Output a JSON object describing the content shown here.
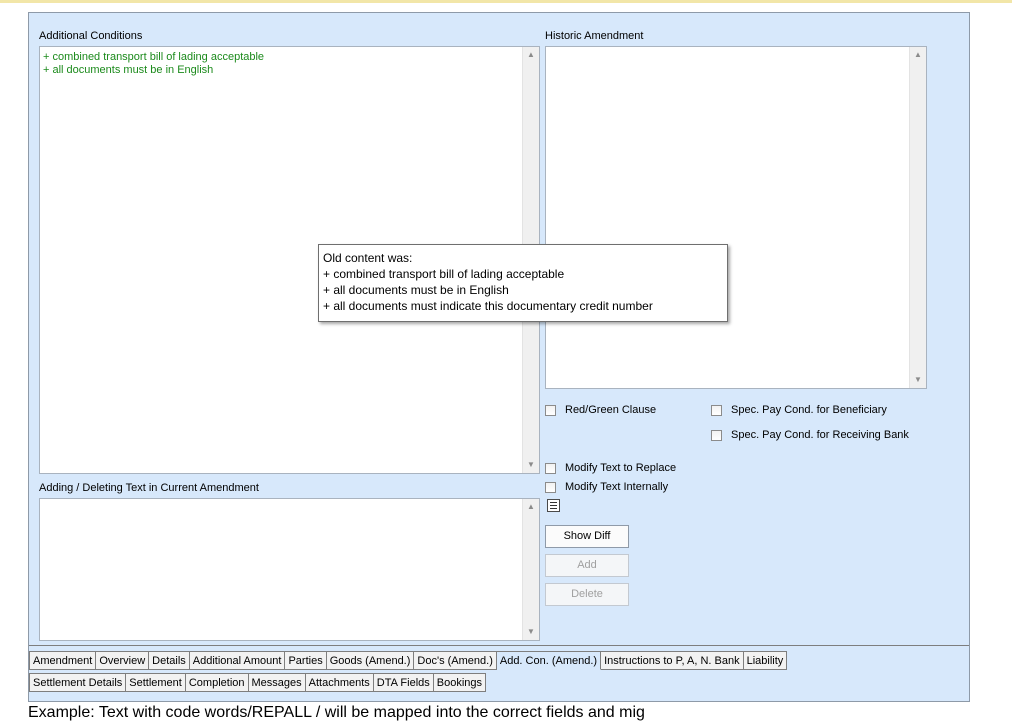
{
  "labels": {
    "additional_conditions": "Additional Conditions",
    "historic_amendment": "Historic Amendment",
    "adding_deleting": "Adding / Deleting Text in Current Amendment"
  },
  "additional_conditions_lines": [
    "+ combined transport bill of lading acceptable",
    "+ all documents must be in English"
  ],
  "tooltip": {
    "lines": [
      "Old content was:",
      "+ combined transport bill of lading acceptable",
      "+ all documents must be in English",
      "+ all documents must indicate this documentary credit number"
    ]
  },
  "checkboxes": {
    "red_green_clause": "Red/Green Clause",
    "spec_pay_beneficiary": "Spec. Pay Cond. for Beneficiary",
    "spec_pay_receiving_bank": "Spec. Pay Cond. for Receiving Bank",
    "modify_text_replace": "Modify Text to Replace",
    "modify_text_internally": "Modify Text Internally"
  },
  "buttons": {
    "show_diff": "Show Diff",
    "add": "Add",
    "delete": "Delete"
  },
  "tabs_row1": [
    "Amendment",
    "Overview",
    "Details",
    "Additional Amount",
    "Parties",
    "Goods (Amend.)",
    "Doc's (Amend.)",
    "Add. Con. (Amend.)",
    "Instructions to P, A, N. Bank",
    "Liability"
  ],
  "active_tab": "Add. Con. (Amend.)",
  "tabs_row2": [
    "Settlement Details",
    "Settlement",
    "Completion",
    "Messages",
    "Attachments",
    "DTA Fields",
    "Bookings"
  ],
  "footer_text": "Example: Text with code words/REPALL / will be mapped into the correct fields and mig"
}
